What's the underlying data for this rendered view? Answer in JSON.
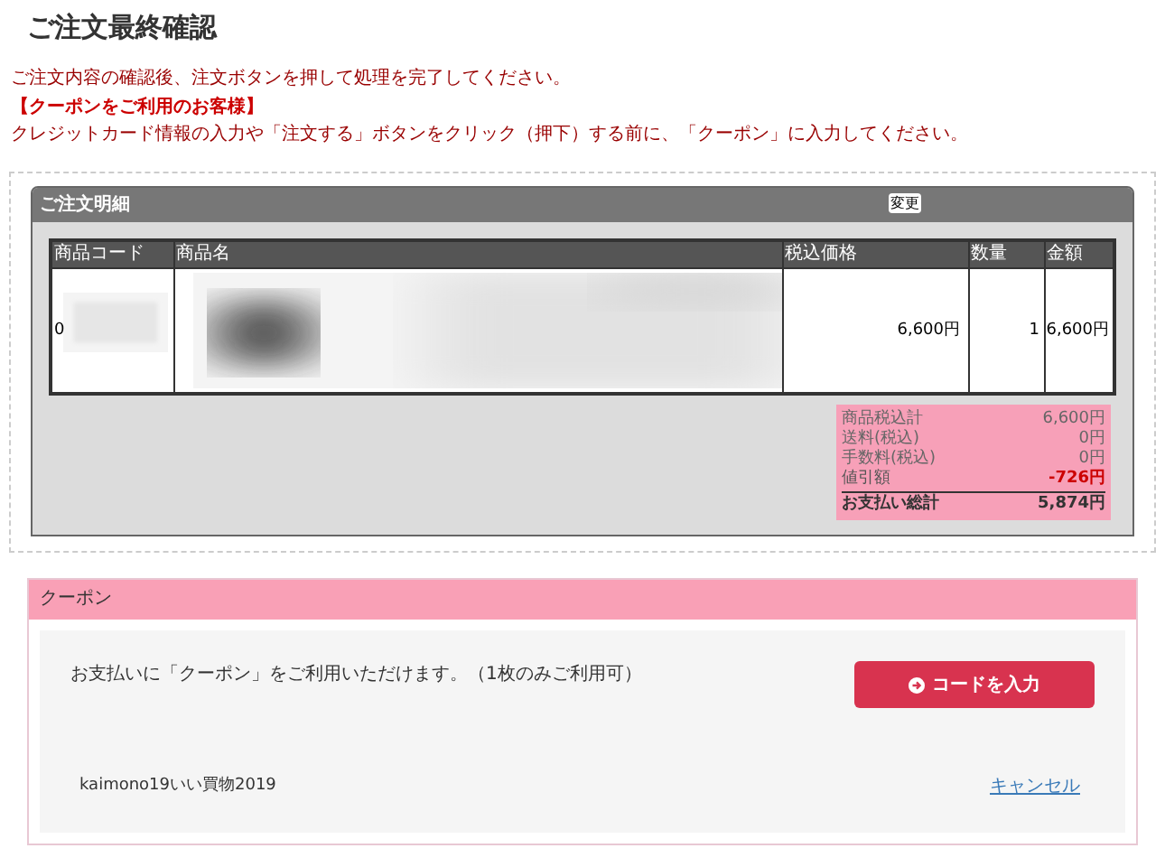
{
  "page_title": "ご注文最終確認",
  "notices": [
    {
      "kind": "plain",
      "text": "ご注文内容の確認後、注文ボタンを押して処理を完了してください。"
    },
    {
      "kind": "heading",
      "text": "【クーポンをご利用のお客様】"
    },
    {
      "kind": "plain",
      "text": "クレジットカード情報の入力や「注文する」ボタンをクリック（押下）する前に、「クーポン」に入力してください。"
    }
  ],
  "order": {
    "title": "ご注文明細",
    "change_button": "変更",
    "columns": [
      "商品コード",
      "商品名",
      "税込価格",
      "数量",
      "金額"
    ],
    "rows": [
      {
        "code": "0",
        "price": "6,600円",
        "quantity": "1",
        "amount": "6,600円"
      }
    ],
    "summary": [
      {
        "kind": "normal",
        "label": "商品税込計",
        "value": "6,600円"
      },
      {
        "kind": "normal",
        "label": "送料(税込)",
        "value": "0円"
      },
      {
        "kind": "normal",
        "label": "手数料(税込)",
        "value": "0円"
      },
      {
        "kind": "discount",
        "label": "値引額",
        "value": "-726円"
      },
      {
        "kind": "total",
        "label": "お支払い総計",
        "value": "5,874円"
      }
    ]
  },
  "coupon": {
    "title": "クーポン",
    "description": "お支払いに「クーポン」をご利用いただけます。（1枚のみご利用可）",
    "button": "コードを入力",
    "applied_code": "kaimono19いい買物2019",
    "cancel_link": "キャンセル"
  }
}
